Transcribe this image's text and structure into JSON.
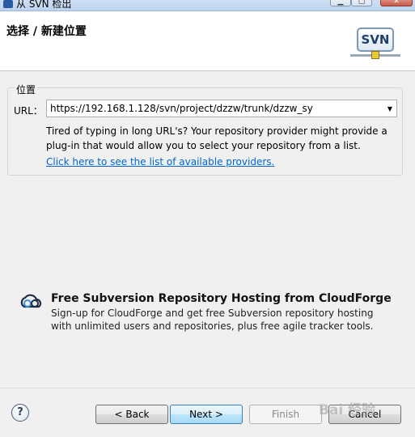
{
  "window": {
    "title": "从 SVN 检出",
    "icon": "svn-app-icon"
  },
  "header": {
    "title": "选择 / 新建位置",
    "logo_text": "SVN"
  },
  "location_group": {
    "label": "位置",
    "url_label": "URL：",
    "url_value": "https://192.168.1.128/svn/project/dzzw/trunk/dzzw_sy",
    "hint": "Tired of typing in long URL's?  Your repository provider might provide a plug-in that would allow you to select your repository from a list.",
    "providers_link": "Click here to see the list of available providers."
  },
  "promo": {
    "icon": "cloudforge-icon",
    "title": "Free Subversion Repository Hosting from CloudForge",
    "description": "Sign-up for CloudForge and get free Subversion repository hosting with unlimited users and repositories, plus free agile tracker tools."
  },
  "buttons": {
    "help": "?",
    "back": "< Back",
    "next": "Next >",
    "finish": "Finish",
    "cancel": "Cancel"
  },
  "watermark": {
    "text": "Bai 经验"
  },
  "colors": {
    "link": "#0066cc",
    "next_button_accent": "#3c7fb1"
  }
}
